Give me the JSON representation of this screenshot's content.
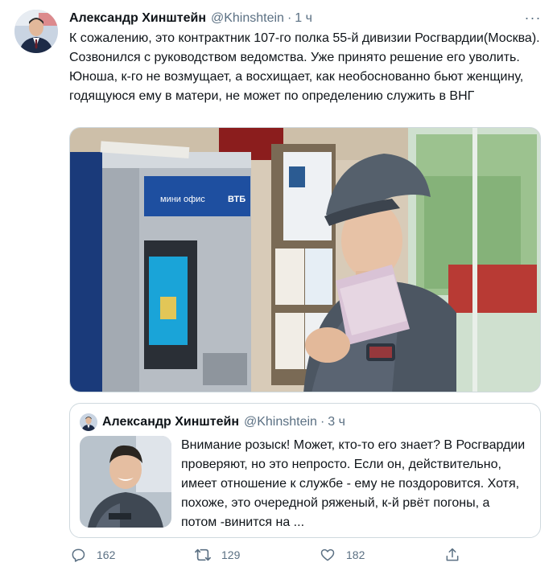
{
  "tweet": {
    "author_name": "Александр Хинштейн",
    "author_handle": "@Khinshtein",
    "separator": "·",
    "time": "1 ч",
    "more_label": "···",
    "text": "К сожалению, это контрактник 107-го полка 55-й дивизии Росгвардии(Москва). Созвонился с руководством ведомства. Уже принято решение его уволить. Юноша, к-го не возмущает, а восхищает, как необоснованно бьют женщину, годящуюся ему в матери, не может по определению служить в ВНГ",
    "photo": {
      "atm_brand": "ВТБ",
      "atm_sign": "мини офис"
    }
  },
  "quoted": {
    "author_name": "Александр Хинштейн",
    "author_handle": "@Khinshtein",
    "separator": "·",
    "time": "3 ч",
    "text": "Внимание розыск! Может, кто-то его знает? В Росгвардии проверяют, но это непросто. Если он, действительно, имеет отношение к службе - ему не поздоровится. Хотя, похоже, это очередной ряженый, к-й рвёт погоны, а потом -винится на ..."
  },
  "actions": {
    "reply_count": "162",
    "retweet_count": "129",
    "like_count": "182"
  },
  "colors": {
    "text": "#0f1419",
    "secondary": "#5b7083",
    "border": "#cfd9de"
  }
}
